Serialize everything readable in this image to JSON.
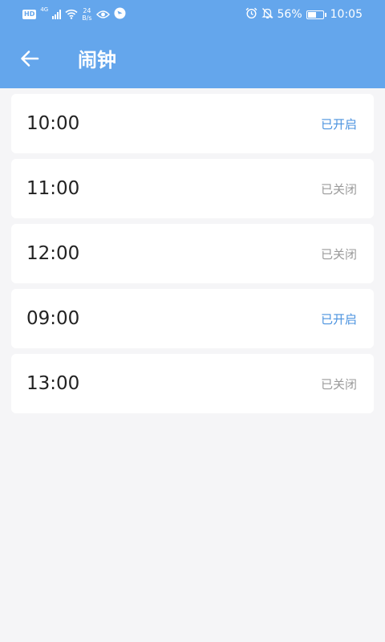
{
  "status_bar": {
    "hd_label": "HD",
    "network_label": "4G",
    "speed_value": "24",
    "speed_unit": "B/s",
    "battery_percent": "56%",
    "battery_level": 0.56,
    "time": "10:05",
    "icons": [
      "hd-icon",
      "signal-icon",
      "wifi-icon",
      "eye-icon",
      "app-notify-icon",
      "alarm-clock-icon",
      "mute-bell-icon",
      "battery-icon"
    ]
  },
  "header": {
    "title": "闹钟",
    "back_icon": "arrow-left-icon",
    "background_color": "#64a6ec"
  },
  "alarms": [
    {
      "time": "10:00",
      "status": "已开启",
      "enabled": true
    },
    {
      "time": "11:00",
      "status": "已关闭",
      "enabled": false
    },
    {
      "time": "12:00",
      "status": "已关闭",
      "enabled": false
    },
    {
      "time": "09:00",
      "status": "已开启",
      "enabled": true
    },
    {
      "time": "13:00",
      "status": "已关闭",
      "enabled": false
    }
  ],
  "colors": {
    "status_on": "#4a92df",
    "status_off": "#9a9a9a",
    "page_background": "#f5f5f7"
  }
}
